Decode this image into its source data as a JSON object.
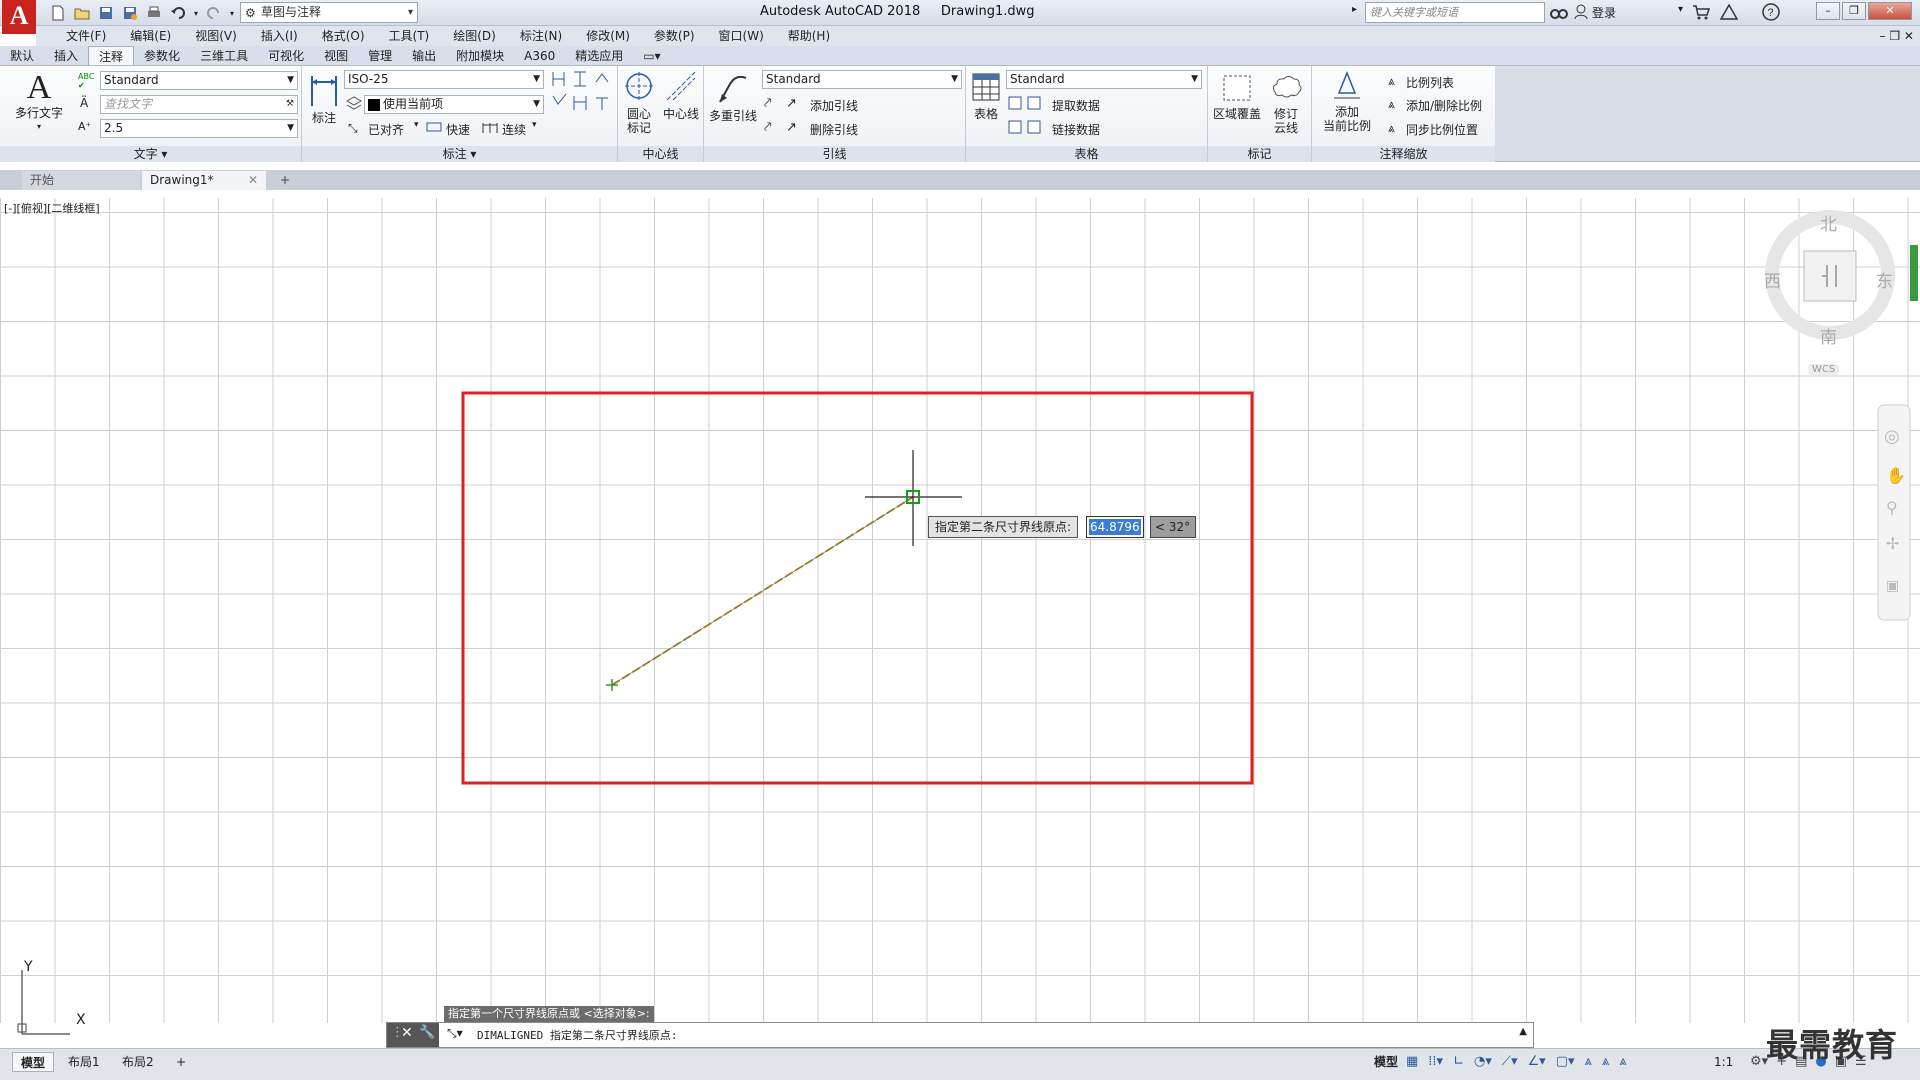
{
  "title_bar": {
    "logo": "A",
    "workspace": "草图与注释",
    "app_title": "Autodesk AutoCAD 2018",
    "drawing_name": "Drawing1.dwg",
    "search_placeholder": "键入关键字或短语",
    "login": "登录"
  },
  "menu": [
    "文件(F)",
    "编辑(E)",
    "视图(V)",
    "插入(I)",
    "格式(O)",
    "工具(T)",
    "绘图(D)",
    "标注(N)",
    "修改(M)",
    "参数(P)",
    "窗口(W)",
    "帮助(H)"
  ],
  "ribbon_tabs": [
    "默认",
    "插入",
    "注释",
    "参数化",
    "三维工具",
    "可视化",
    "视图",
    "管理",
    "输出",
    "附加模块",
    "A360",
    "精选应用"
  ],
  "ribbon_active_tab": "注释",
  "panels": {
    "text": {
      "title": "文字",
      "big_button": "多行文字",
      "style": "Standard",
      "find_placeholder": "查找文字",
      "height": "2.5"
    },
    "dimension": {
      "title": "标注",
      "big_button": "标注",
      "style": "ISO-25",
      "layer": "使用当前项",
      "align": "已对齐",
      "quick": "快速",
      "continue": "连续"
    },
    "centerline": {
      "title": "中心线",
      "center_mark": "圆心\n标记",
      "center_mark_1": "圆心",
      "center_mark_2": "标记",
      "centerline_btn": "中心线"
    },
    "leader": {
      "title": "引线",
      "big_button": "多重引线",
      "style": "Standard",
      "add": "添加引线",
      "remove": "删除引线"
    },
    "table": {
      "title": "表格",
      "big_button": "表格",
      "style": "Standard",
      "extract": "提取数据",
      "link": "链接数据"
    },
    "markup": {
      "title": "标记",
      "wipeout": "区域覆盖",
      "revcloud_1": "修订",
      "revcloud_2": "云线"
    },
    "scale": {
      "title": "注释缩放",
      "add_1": "添加",
      "add_2": "当前比例",
      "scale_list": "比例列表",
      "add_delete": "添加/删除比例",
      "sync": "同步比例位置"
    }
  },
  "file_tabs": {
    "start": "开始",
    "drawing": "Drawing1*",
    "add": "+"
  },
  "viewport_label": "[-][俯视][二维线框]",
  "viewcube": {
    "north": "北",
    "south": "南",
    "east": "东",
    "west": "西",
    "wcs": "WCS"
  },
  "dynamic_input": {
    "prompt": "指定第二条尺寸界线原点:",
    "value": "64.8796",
    "angle": "< 32°"
  },
  "command": {
    "history": "指定第一个尺寸界线原点或 <选择对象>:",
    "current": "DIMALIGNED 指定第二条尺寸界线原点:"
  },
  "status": {
    "model_tab": "模型",
    "layout1": "布局1",
    "layout2": "布局2",
    "add": "+",
    "model": "模型",
    "scale": "1:1"
  },
  "ucs": {
    "x": "X",
    "y": "Y"
  },
  "watermark": "最需教育",
  "colors": {
    "rectangle": "#e02020",
    "dimension_line": "#c89a2a",
    "grid": "#cfcfcf",
    "logo": "#c8231d",
    "selection": "#3b7cd6"
  }
}
